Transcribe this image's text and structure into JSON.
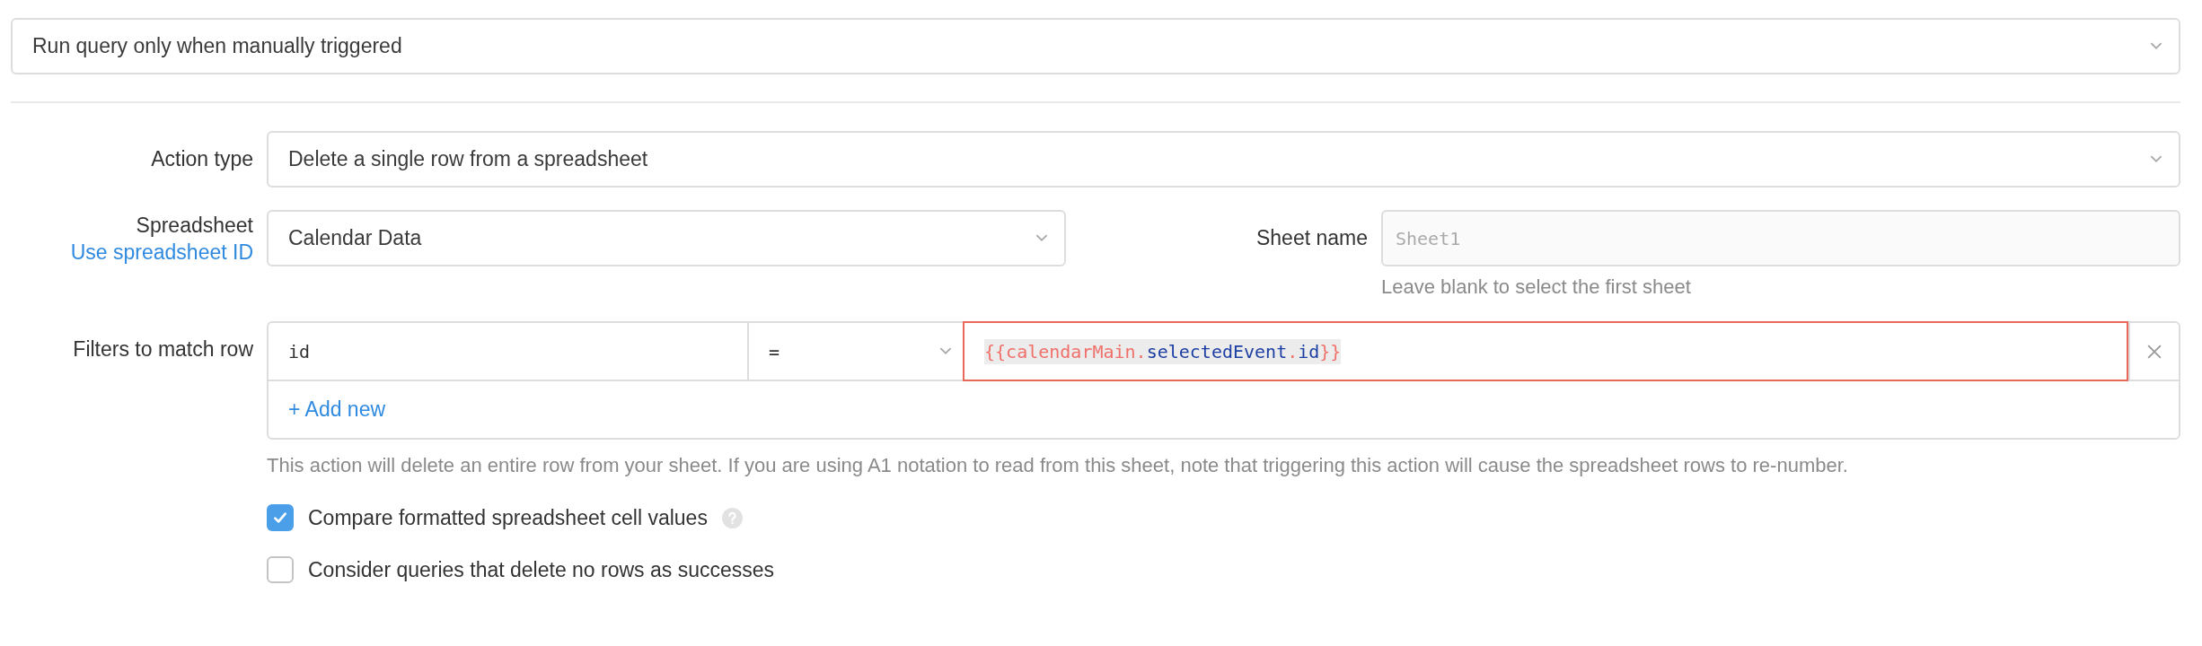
{
  "trigger": {
    "value": "Run query only when manually triggered"
  },
  "action_type": {
    "label": "Action type",
    "value": "Delete a single row from a spreadsheet"
  },
  "spreadsheet": {
    "label": "Spreadsheet",
    "link": "Use spreadsheet ID",
    "value": "Calendar Data"
  },
  "sheet_name": {
    "label": "Sheet name",
    "placeholder": "Sheet1",
    "hint": "Leave blank to select the first sheet"
  },
  "filters": {
    "label": "Filters to match row",
    "rows": [
      {
        "column": "id",
        "operator": "=",
        "error": true,
        "value_tokens": [
          {
            "text": "{{",
            "kind": "brace"
          },
          {
            "text": "calendarMain",
            "kind": "ident"
          },
          {
            "text": ".",
            "kind": "dot"
          },
          {
            "text": "selectedEvent",
            "kind": "prop"
          },
          {
            "text": ".",
            "kind": "dot"
          },
          {
            "text": "id",
            "kind": "prop"
          },
          {
            "text": "}}",
            "kind": "brace"
          }
        ]
      }
    ],
    "add_button": "+ Add new",
    "note": "This action will delete an entire row from your sheet. If you are using A1 notation to read from this sheet, note that triggering this action will cause the spreadsheet rows to re-number."
  },
  "options": [
    {
      "label": "Compare formatted spreadsheet cell values",
      "checked": true,
      "help": true
    },
    {
      "label": "Consider queries that delete no rows as successes",
      "checked": false,
      "help": false
    }
  ]
}
